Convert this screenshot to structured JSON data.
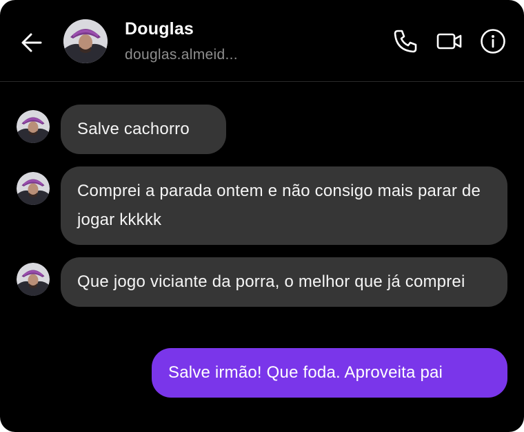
{
  "header": {
    "name": "Douglas",
    "username": "douglas.almeid...",
    "back_icon": "arrow-left-icon",
    "call_icon": "phone-icon",
    "video_icon": "video-camera-icon",
    "info_icon": "info-circle-icon"
  },
  "messages": [
    {
      "direction": "incoming",
      "text": "Salve cachorro"
    },
    {
      "direction": "incoming",
      "text": "Comprei a parada ontem e não consigo mais parar de jogar kkkkk"
    },
    {
      "direction": "incoming",
      "text": "Que jogo viciante da porra, o melhor que já comprei"
    },
    {
      "direction": "outgoing",
      "text": "Salve irmão! Que foda. Aproveita pai"
    }
  ],
  "colors": {
    "background": "#000000",
    "incoming_bubble": "#363636",
    "outgoing_bubble": "#7a36ea",
    "secondary_text": "#8e8e8e"
  }
}
